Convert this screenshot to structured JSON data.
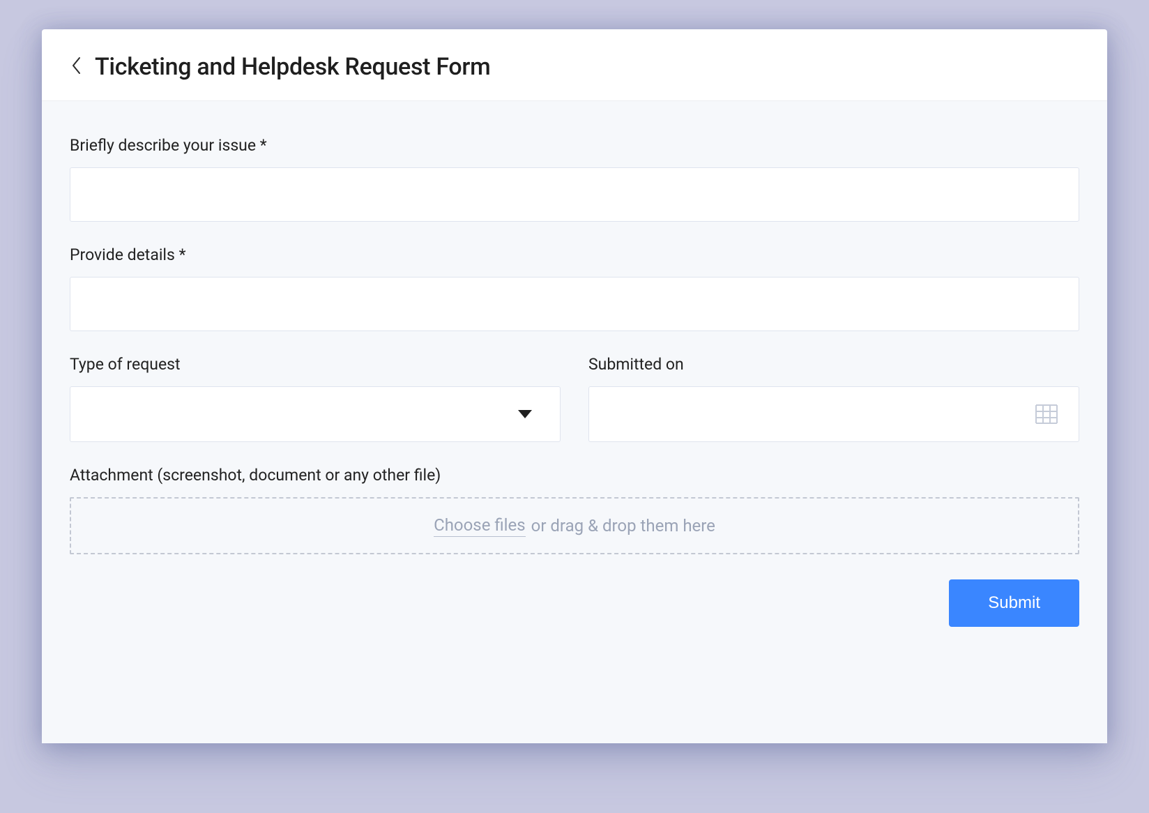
{
  "header": {
    "title": "Ticketing and Helpdesk Request Form"
  },
  "form": {
    "issue": {
      "label": "Briefly describe your issue *",
      "value": ""
    },
    "details": {
      "label": "Provide details *",
      "value": ""
    },
    "request_type": {
      "label": "Type of request",
      "value": ""
    },
    "submitted_on": {
      "label": "Submitted on",
      "value": ""
    },
    "attachment": {
      "label": "Attachment (screenshot, document or any other file)",
      "choose_label": "Choose files",
      "drop_label": " or drag & drop them here"
    },
    "submit_label": "Submit"
  },
  "colors": {
    "page_bg": "#c7c8e0",
    "body_bg": "#f6f8fb",
    "primary": "#3a86ff",
    "border": "#dfe4ee"
  }
}
